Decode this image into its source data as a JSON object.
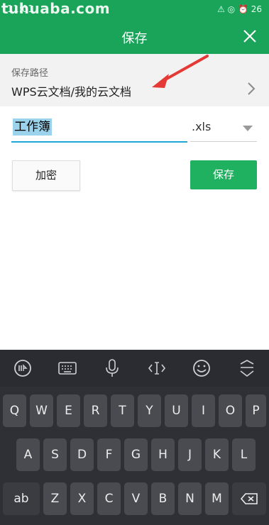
{
  "watermark": "tuhuaba.com",
  "statusbar": {
    "time": "11:01",
    "icons": "⚠ ◎ ⏰ 26"
  },
  "appbar": {
    "title": "保存"
  },
  "save_path": {
    "label": "保存路径",
    "value": "WPS云文档/我的云文档"
  },
  "filename": {
    "value": "工作簿",
    "extension": ".xls"
  },
  "buttons": {
    "encrypt": "加密",
    "save": "保存"
  },
  "keyboard": {
    "row1": [
      "Q",
      "W",
      "E",
      "R",
      "T",
      "Y",
      "U",
      "I",
      "O",
      "P"
    ],
    "row2": [
      "A",
      "S",
      "D",
      "F",
      "G",
      "H",
      "J",
      "K",
      "L"
    ],
    "row3_left": "ab",
    "row3": [
      "Z",
      "X",
      "C",
      "V",
      "B",
      "N",
      "M"
    ]
  },
  "colors": {
    "accent": "#1aa45a",
    "save_button": "#1fb15f",
    "underline": "#22a5d7",
    "keyboard_bg": "#2b2c31",
    "annotation_arrow": "#e53935"
  }
}
